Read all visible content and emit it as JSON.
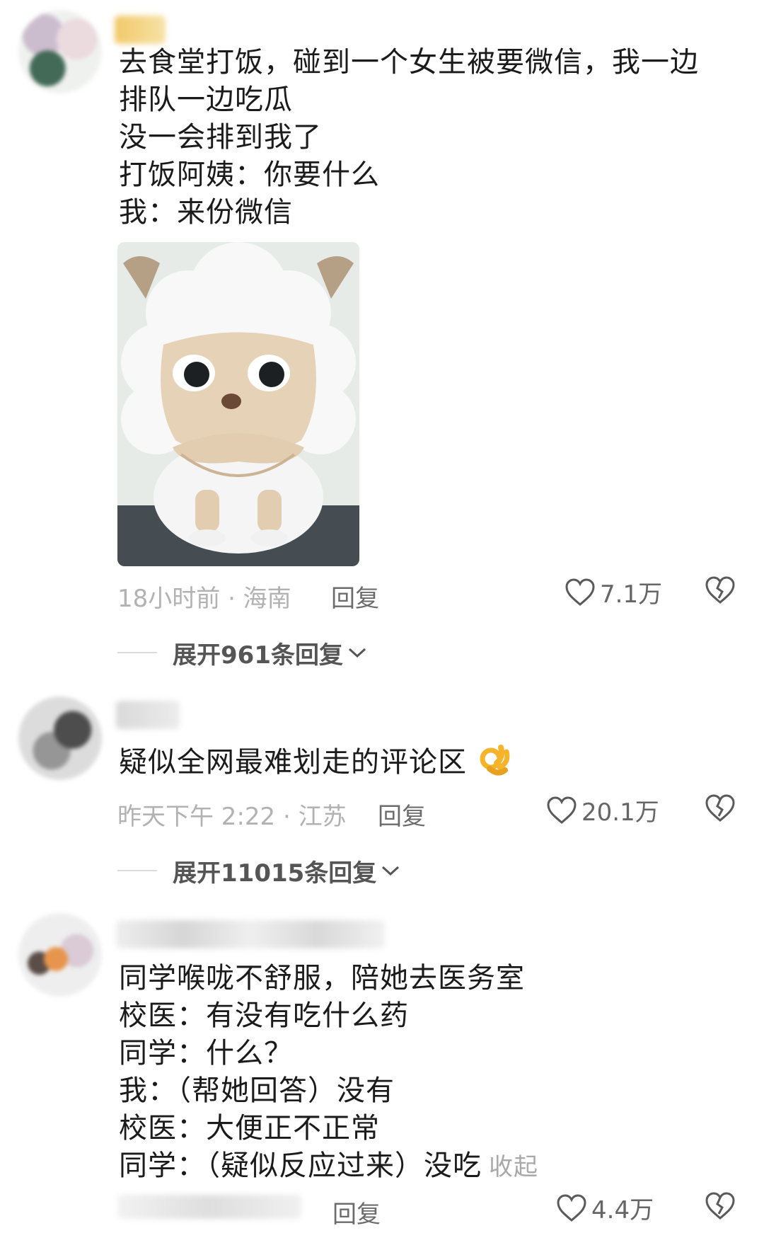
{
  "comments": [
    {
      "lines": [
        "去食堂打饭，碰到一个女生被要微信，我一边",
        "排队一边吃瓜",
        "没一会排到我了",
        "打饭阿姨：你要什么",
        "我：来份微信"
      ],
      "time_location": "18小时前 · 海南",
      "reply_label": "回复",
      "likes": "7.1万",
      "expand_label": "展开961条回复"
    },
    {
      "lines": [
        "疑似全网最难划走的评论区"
      ],
      "time_location": "昨天下午 2:22 · 江苏",
      "reply_label": "回复",
      "likes": "20.1万",
      "expand_label": "展开11015条回复"
    },
    {
      "lines": [
        "同学喉咙不舒服，陪她去医务室",
        "校医：有没有吃什么药",
        "同学：什么？",
        "我：（帮她回答）没有",
        "校医：大便正不正常",
        "同学：（疑似反应过来）没吃"
      ],
      "collapse_label": "收起",
      "reply_label": "回复",
      "likes": "4.4万"
    }
  ]
}
